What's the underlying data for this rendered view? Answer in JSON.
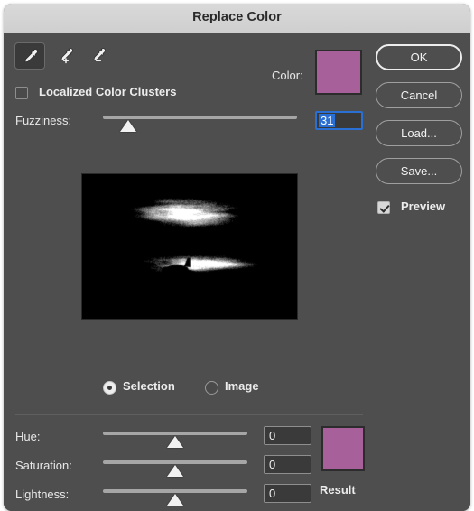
{
  "dialog": {
    "title": "Replace Color"
  },
  "tools": {
    "eyedropper": "eyedropper-tool",
    "eyedropper_add": "eyedropper-add-tool",
    "eyedropper_subtract": "eyedropper-subtract-tool",
    "selected": "eyedropper-tool"
  },
  "color": {
    "label": "Color:",
    "swatch_hex": "#a8609a"
  },
  "localized_color_clusters": {
    "label": "Localized Color Clusters",
    "checked": false
  },
  "fuzziness": {
    "label": "Fuzziness:",
    "value": "31",
    "slider_percent": 13,
    "field_focused": true,
    "focus_hex": "#2a6fd4"
  },
  "preview_mode": {
    "selection_label": "Selection",
    "image_label": "Image",
    "selected": "Selection"
  },
  "adjustments": {
    "rows": [
      {
        "label": "Hue:",
        "value": "0",
        "slider_percent": 50
      },
      {
        "label": "Saturation:",
        "value": "0",
        "slider_percent": 50
      },
      {
        "label": "Lightness:",
        "value": "0",
        "slider_percent": 50
      }
    ],
    "result_label": "Result",
    "result_hex": "#a8609a"
  },
  "buttons": {
    "ok": "OK",
    "cancel": "Cancel",
    "load": "Load...",
    "save": "Save..."
  },
  "preview_checkbox": {
    "label": "Preview",
    "checked": true
  }
}
